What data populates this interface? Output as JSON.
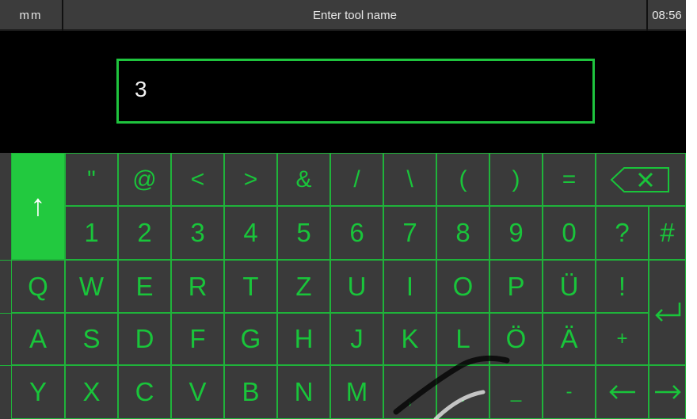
{
  "header": {
    "unit": "mm",
    "title": "Enter tool name",
    "time": "08:56"
  },
  "input": {
    "value": "3"
  },
  "keyboard": {
    "row1": [
      "\"",
      "@",
      "<",
      ">",
      "&",
      "/",
      "\\",
      "(",
      ")",
      "="
    ],
    "row2": [
      "1",
      "2",
      "3",
      "4",
      "5",
      "6",
      "7",
      "8",
      "9",
      "0",
      "?",
      "#"
    ],
    "row3": [
      "W",
      "E",
      "R",
      "T",
      "Z",
      "U",
      "I",
      "O",
      "P",
      "Ü",
      "!"
    ],
    "row4": [
      "S",
      "D",
      "F",
      "G",
      "H",
      "J",
      "K",
      "L",
      "Ö",
      "Ä",
      "+"
    ],
    "row5": [
      "X",
      "C",
      "V",
      "B",
      "N",
      "M",
      ",",
      ".",
      "_",
      "-"
    ],
    "left_col": [
      "Q",
      "A",
      "Y"
    ]
  },
  "icons": {
    "shift": "shift-arrow-up-icon",
    "backspace": "backspace-icon",
    "enter": "enter-return-icon",
    "left": "arrow-left-icon",
    "right": "arrow-right-icon"
  },
  "colors": {
    "accent": "#1fc43e",
    "key_bg": "#3a3a3a",
    "header_bg": "#3c3c3c"
  }
}
